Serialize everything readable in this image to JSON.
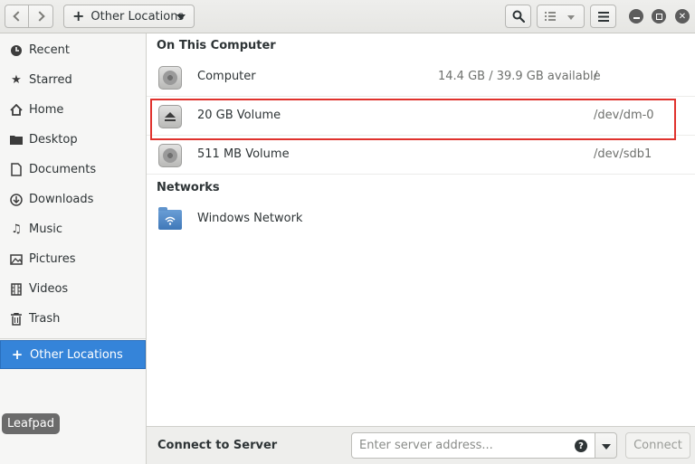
{
  "toolbar": {
    "path_label": "Other Locations"
  },
  "sidebar": {
    "items": [
      {
        "label": "Recent",
        "icon": "clock-icon"
      },
      {
        "label": "Starred",
        "icon": "star-icon"
      },
      {
        "label": "Home",
        "icon": "home-icon"
      },
      {
        "label": "Desktop",
        "icon": "folder-icon"
      },
      {
        "label": "Documents",
        "icon": "document-icon"
      },
      {
        "label": "Downloads",
        "icon": "download-icon"
      },
      {
        "label": "Music",
        "icon": "music-icon"
      },
      {
        "label": "Pictures",
        "icon": "picture-icon"
      },
      {
        "label": "Videos",
        "icon": "film-icon"
      },
      {
        "label": "Trash",
        "icon": "trash-icon"
      }
    ],
    "other_locations": {
      "label": "Other Locations",
      "icon": "plus-icon",
      "active": true
    }
  },
  "main": {
    "on_this_computer": {
      "header": "On This Computer",
      "rows": [
        {
          "name": "Computer",
          "available": "14.4 GB / 39.9 GB available",
          "target": "/",
          "icon": "harddisk-icon"
        },
        {
          "name": "20 GB Volume",
          "available": "",
          "target": "/dev/dm-0",
          "icon": "eject-icon",
          "highlighted": true
        },
        {
          "name": "511 MB Volume",
          "available": "",
          "target": "/dev/sdb1",
          "icon": "harddisk-icon"
        }
      ]
    },
    "networks": {
      "header": "Networks",
      "rows": [
        {
          "name": "Windows Network",
          "icon": "network-folder-icon"
        }
      ]
    }
  },
  "bottom_bar": {
    "label": "Connect to Server",
    "placeholder": "Enter server address...",
    "connect_label": "Connect"
  },
  "taskbar_tooltip": {
    "label": "Leafpad"
  },
  "colors": {
    "accent": "#3584d9",
    "highlight_border": "#e0322d"
  }
}
